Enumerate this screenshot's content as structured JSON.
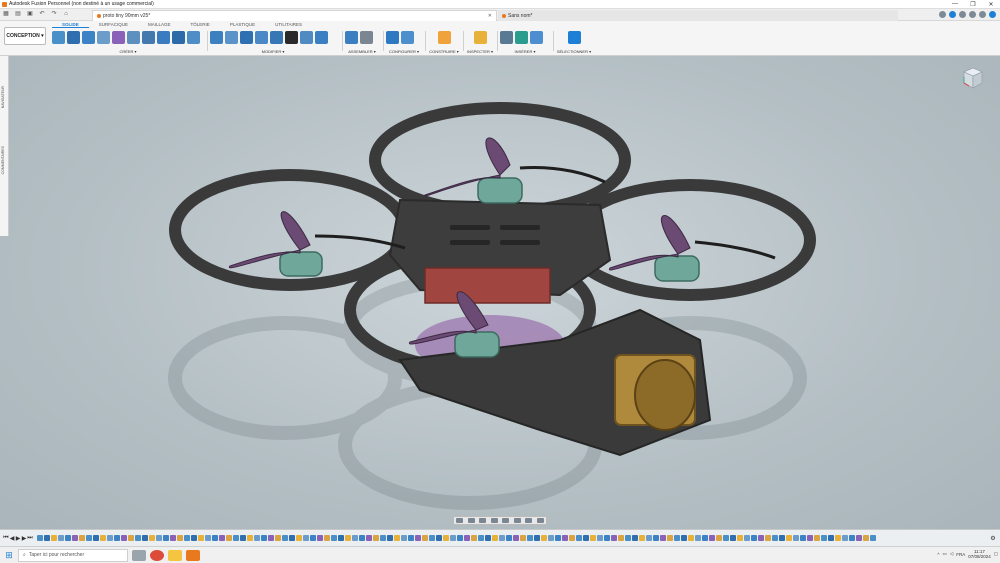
{
  "window": {
    "title": "Autodesk Fusion Personnel (non destiné à un usage commercial)",
    "controls": [
      "—",
      "❐",
      "✕"
    ]
  },
  "tabs": {
    "active": "proto tiny 90mm v25*",
    "other": "Sans nom*"
  },
  "workspace": {
    "button": "CONCEPTION ▾",
    "tabs": [
      "SOLIDE",
      "SURFACIQUE",
      "MAILLAGE",
      "TÔLERIE",
      "PLASTIQUE",
      "UTILITAIRES"
    ]
  },
  "toolbar_groups": [
    {
      "label": "CRÉER ▾"
    },
    {
      "label": "MODIFIER ▾"
    },
    {
      "label": "ASSEMBLER ▾"
    },
    {
      "label": "CONFIGURER ▾"
    },
    {
      "label": "CONSTRUIRE ▾"
    },
    {
      "label": "INSPECTER ▾"
    },
    {
      "label": "INSÉRER ▾"
    },
    {
      "label": "SÉLECTIONNER ▾"
    }
  ],
  "left_panel": {
    "navigateur": "NAVIGATEUR",
    "commentaires": "COMMENTAIRES"
  },
  "taskbar": {
    "search_placeholder": "Taper ici pour rechercher",
    "lang": "FRA",
    "time": "11:17",
    "date": "07/08/2024"
  },
  "colors": {
    "accent": "#1e7fd6",
    "frame": "#3a3a3a",
    "prop": "#6b4a73",
    "motor": "#6fa89a",
    "camera": "#b08a3c"
  }
}
